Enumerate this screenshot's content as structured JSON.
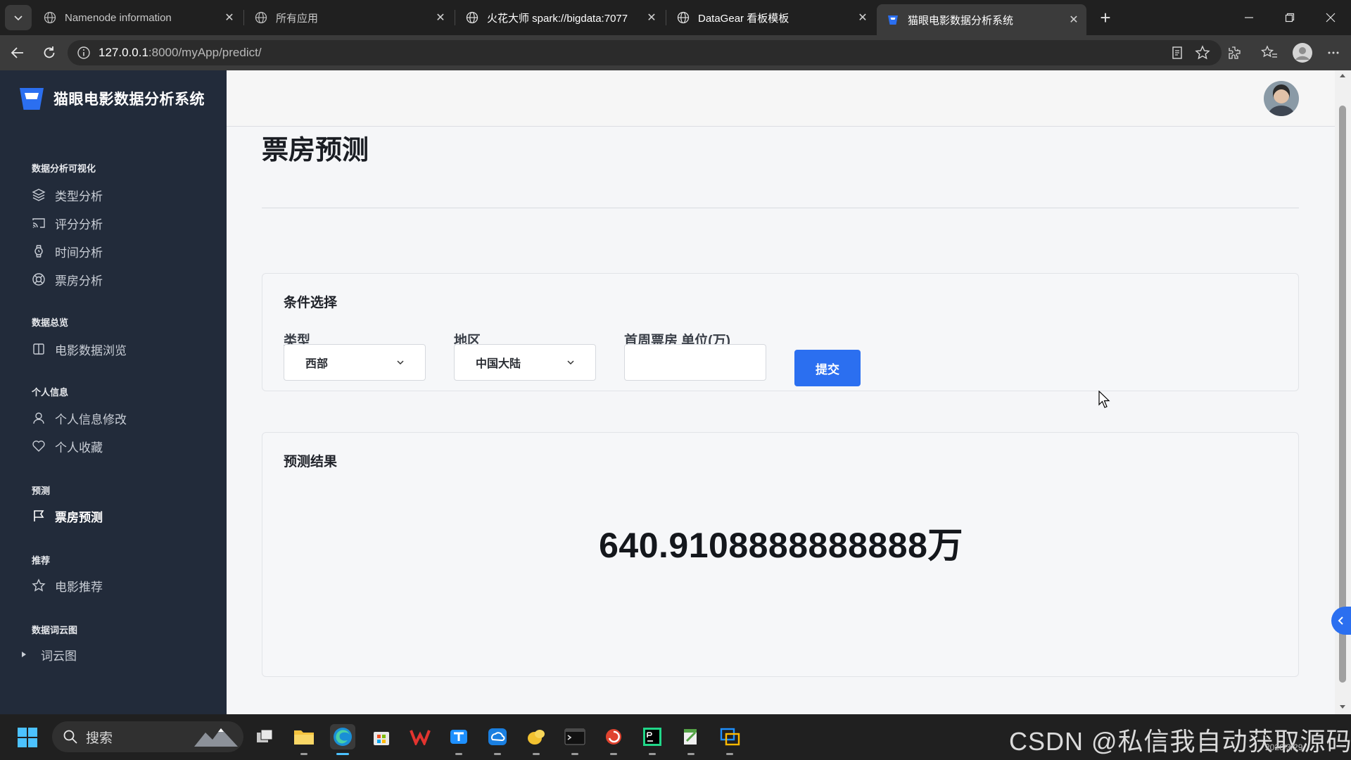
{
  "browser": {
    "tabs": [
      {
        "title": "Namenode information",
        "active": false
      },
      {
        "title": "所有应用",
        "active": false
      },
      {
        "title": "火花大师 spark://bigdata:7077",
        "active": false
      },
      {
        "title": "DataGear 看板模板",
        "active": false
      },
      {
        "title": "猫眼电影数据分析系统",
        "active": true
      }
    ],
    "url_host": "127.0.0.1",
    "url_path": ":8000/myApp/predict/"
  },
  "app": {
    "brand": "猫眼电影数据分析系统",
    "sidebar": {
      "sections": [
        {
          "label": "数据分析可视化",
          "items": [
            {
              "label": "类型分析",
              "icon": "layers-icon"
            },
            {
              "label": "评分分析",
              "icon": "cast-icon"
            },
            {
              "label": "时间分析",
              "icon": "watch-icon"
            },
            {
              "label": "票房分析",
              "icon": "lifebuoy-icon"
            }
          ]
        },
        {
          "label": "数据总览",
          "items": [
            {
              "label": "电影数据浏览",
              "icon": "columns-icon"
            }
          ]
        },
        {
          "label": "个人信息",
          "items": [
            {
              "label": "个人信息修改",
              "icon": "user-icon"
            },
            {
              "label": "个人收藏",
              "icon": "heart-icon"
            }
          ]
        },
        {
          "label": "预测",
          "items": [
            {
              "label": "票房预测",
              "icon": "flag-icon",
              "active": true
            }
          ]
        },
        {
          "label": "推荐",
          "items": [
            {
              "label": "电影推荐",
              "icon": "star-icon"
            }
          ]
        },
        {
          "label": "数据词云图",
          "items": [
            {
              "label": "词云图",
              "icon": "chevron-right-icon"
            }
          ]
        }
      ]
    },
    "page_title": "票房预测",
    "conditions": {
      "title": "条件选择",
      "type_label": "类型",
      "type_value": "西部",
      "region_label": "地区",
      "region_value": "中国大陆",
      "boxoffice_label": "首周票房 单位(万)",
      "boxoffice_value": "",
      "submit_label": "提交"
    },
    "result": {
      "title": "预测结果",
      "value": "640.9108888888888万"
    },
    "accent_color": "#2b6ff0",
    "sidebar_color": "#222b3a"
  },
  "taskbar": {
    "search_label": "搜索",
    "watermark": "CSDN @私信我自动获取源码",
    "date": "2026/3/29"
  }
}
